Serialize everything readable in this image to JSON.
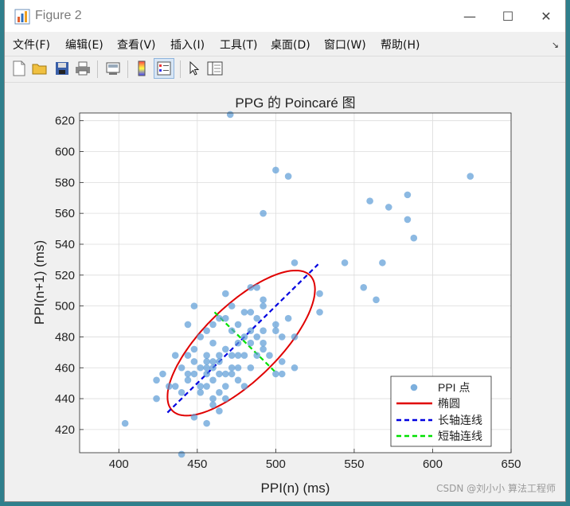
{
  "window": {
    "title": "Figure 2",
    "minimize_glyph": "—",
    "maximize_glyph": "☐",
    "close_glyph": "✕"
  },
  "menu": [
    "文件(F)",
    "编辑(E)",
    "查看(V)",
    "插入(I)",
    "工具(T)",
    "桌面(D)",
    "窗口(W)",
    "帮助(H)"
  ],
  "toolbar_icons": [
    "new-file-icon",
    "open-folder-icon",
    "save-icon",
    "print-icon",
    "link-plot-icon",
    "colorbar-icon",
    "legend-icon",
    "pointer-icon",
    "property-inspector-icon"
  ],
  "watermark": "CSDN @刘小小 算法工程师",
  "colors": {
    "points": "#5b9bd5",
    "ellipse": "#e00000",
    "major_axis": "#0000e0",
    "minor_axis": "#00e000"
  },
  "chart_data": {
    "type": "scatter",
    "title": "PPG 的 Poincaré 图",
    "xlabel": "PPI(n) (ms)",
    "ylabel": "PPI(n+1) (ms)",
    "xlim": [
      375,
      650
    ],
    "ylim": [
      405,
      625
    ],
    "xticks": [
      400,
      450,
      500,
      550,
      600,
      650
    ],
    "yticks": [
      420,
      440,
      460,
      480,
      500,
      520,
      540,
      560,
      580,
      600,
      620
    ],
    "grid": true,
    "legend_position": "bottom-right",
    "legend": [
      "PPI 点",
      "椭圆",
      "长轴连线",
      "短轴连线"
    ],
    "points": [
      [
        471,
        624
      ],
      [
        500,
        588
      ],
      [
        508,
        584
      ],
      [
        624,
        584
      ],
      [
        560,
        568
      ],
      [
        584,
        572
      ],
      [
        572,
        564
      ],
      [
        584,
        556
      ],
      [
        588,
        544
      ],
      [
        492,
        560
      ],
      [
        512,
        528
      ],
      [
        544,
        528
      ],
      [
        568,
        528
      ],
      [
        556,
        512
      ],
      [
        564,
        504
      ],
      [
        528,
        508
      ],
      [
        528,
        496
      ],
      [
        448,
        500
      ],
      [
        468,
        508
      ],
      [
        484,
        512
      ],
      [
        488,
        512
      ],
      [
        472,
        500
      ],
      [
        480,
        496
      ],
      [
        484,
        496
      ],
      [
        492,
        500
      ],
      [
        492,
        504
      ],
      [
        508,
        492
      ],
      [
        500,
        488
      ],
      [
        488,
        492
      ],
      [
        476,
        488
      ],
      [
        468,
        492
      ],
      [
        464,
        492
      ],
      [
        460,
        488
      ],
      [
        444,
        488
      ],
      [
        456,
        484
      ],
      [
        472,
        484
      ],
      [
        480,
        480
      ],
      [
        484,
        484
      ],
      [
        492,
        484
      ],
      [
        500,
        484
      ],
      [
        504,
        480
      ],
      [
        512,
        480
      ],
      [
        492,
        476
      ],
      [
        484,
        476
      ],
      [
        476,
        476
      ],
      [
        468,
        472
      ],
      [
        464,
        468
      ],
      [
        460,
        476
      ],
      [
        452,
        480
      ],
      [
        448,
        472
      ],
      [
        456,
        468
      ],
      [
        456,
        464
      ],
      [
        464,
        464
      ],
      [
        472,
        468
      ],
      [
        480,
        468
      ],
      [
        488,
        468
      ],
      [
        492,
        472
      ],
      [
        504,
        464
      ],
      [
        512,
        460
      ],
      [
        504,
        456
      ],
      [
        484,
        460
      ],
      [
        476,
        460
      ],
      [
        468,
        456
      ],
      [
        472,
        456
      ],
      [
        464,
        456
      ],
      [
        456,
        456
      ],
      [
        452,
        460
      ],
      [
        448,
        464
      ],
      [
        444,
        468
      ],
      [
        436,
        468
      ],
      [
        440,
        460
      ],
      [
        428,
        456
      ],
      [
        424,
        452
      ],
      [
        444,
        452
      ],
      [
        452,
        448
      ],
      [
        456,
        448
      ],
      [
        460,
        452
      ],
      [
        468,
        448
      ],
      [
        476,
        452
      ],
      [
        480,
        448
      ],
      [
        468,
        440
      ],
      [
        460,
        440
      ],
      [
        452,
        444
      ],
      [
        440,
        444
      ],
      [
        432,
        448
      ],
      [
        436,
        448
      ],
      [
        424,
        440
      ],
      [
        460,
        436
      ],
      [
        464,
        432
      ],
      [
        448,
        428
      ],
      [
        456,
        424
      ],
      [
        404,
        424
      ],
      [
        440,
        404
      ],
      [
        444,
        456
      ],
      [
        448,
        456
      ],
      [
        460,
        460
      ],
      [
        464,
        444
      ],
      [
        472,
        460
      ],
      [
        496,
        468
      ],
      [
        476,
        468
      ],
      [
        500,
        456
      ],
      [
        488,
        480
      ],
      [
        456,
        460
      ],
      [
        460,
        464
      ]
    ],
    "ellipse": {
      "center": [
        478,
        476
      ],
      "semi_major": 62,
      "semi_minor": 24,
      "angle_deg": 45
    },
    "major_axis_line": [
      [
        431,
        431
      ],
      [
        527,
        527
      ]
    ],
    "minor_axis_line": [
      [
        461,
        496
      ],
      [
        500,
        457
      ]
    ]
  }
}
